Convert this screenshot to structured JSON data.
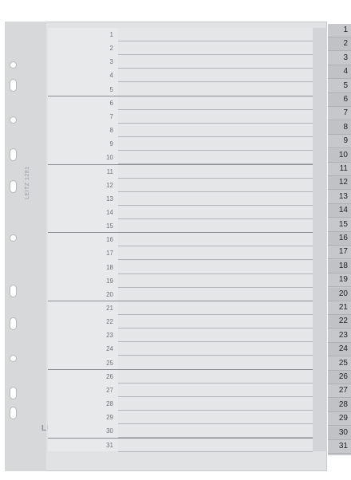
{
  "product": {
    "brand": "LEITZ",
    "code": "LEITZ 1281"
  },
  "rows": [
    "1",
    "2",
    "3",
    "4",
    "5",
    "6",
    "7",
    "8",
    "9",
    "10",
    "11",
    "12",
    "13",
    "14",
    "15",
    "16",
    "17",
    "18",
    "19",
    "20",
    "21",
    "22",
    "23",
    "24",
    "25",
    "26",
    "27",
    "28",
    "29",
    "30",
    "31"
  ],
  "tabs": [
    "1",
    "2",
    "3",
    "4",
    "5",
    "6",
    "7",
    "8",
    "9",
    "10",
    "11",
    "12",
    "13",
    "14",
    "15",
    "16",
    "17",
    "18",
    "19",
    "20",
    "21",
    "22",
    "23",
    "24",
    "25",
    "26",
    "27",
    "28",
    "29",
    "30",
    "31"
  ],
  "colors": {
    "sheet": "#e1e2e4",
    "tab": "#c6c8cb",
    "text": "#707276"
  }
}
